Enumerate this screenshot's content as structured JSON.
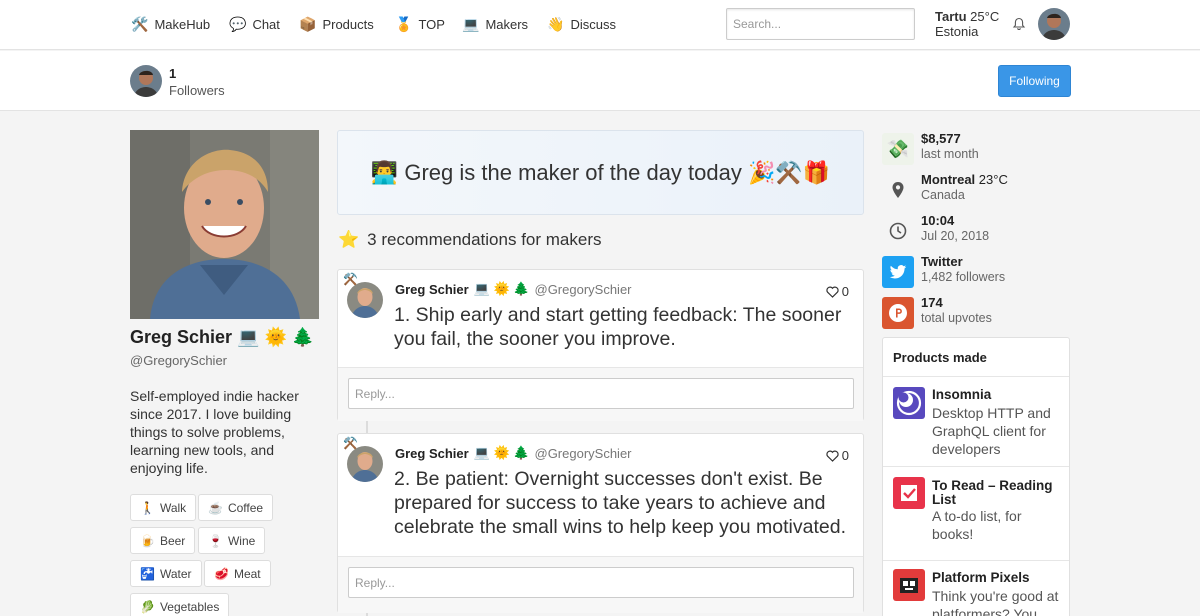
{
  "nav": {
    "items": [
      {
        "icon": "🛠️",
        "label": "MakeHub"
      },
      {
        "icon": "💬",
        "label": "Chat"
      },
      {
        "icon": "📦",
        "label": "Products"
      },
      {
        "icon": "🏅",
        "label": "TOP"
      },
      {
        "icon": "💻",
        "label": "Makers"
      },
      {
        "icon": "👋",
        "label": "Discuss"
      }
    ],
    "search_placeholder": "Search...",
    "weather": {
      "city": "Tartu",
      "temp": "25°C",
      "country": "Estonia"
    }
  },
  "subbar": {
    "followers_count": "1",
    "followers_label": "Followers",
    "button_label": "Following"
  },
  "profile": {
    "name": "Greg Schier 💻 🌞 🌲",
    "handle": "@GregorySchier",
    "bio": "Self-employed indie hacker since 2017. I love building things to solve problems, learning new tools, and enjoying life.",
    "tags": [
      {
        "icon": "🚶",
        "label": "Walk"
      },
      {
        "icon": "☕",
        "label": "Coffee"
      },
      {
        "icon": "🍺",
        "label": "Beer"
      },
      {
        "icon": "🍷",
        "label": "Wine"
      },
      {
        "icon": "🚰",
        "label": "Water"
      },
      {
        "icon": "🥩",
        "label": "Meat"
      },
      {
        "icon": "🥬",
        "label": "Vegetables"
      }
    ]
  },
  "main": {
    "maker_of_day": "👨‍💻 Greg is the maker of the day today 🎉⚒️🎁",
    "recommendations_icon": "⭐",
    "recommendations_title": "3 recommendations for makers",
    "posts": [
      {
        "author": "Greg Schier",
        "author_emoji": "💻 🌞 🌲",
        "handle": "@GregorySchier",
        "likes": "0",
        "text": "1. Ship early and start getting feedback: The sooner you fail, the sooner you improve.",
        "reply_placeholder": "Reply..."
      },
      {
        "author": "Greg Schier",
        "author_emoji": "💻 🌞 🌲",
        "handle": "@GregorySchier",
        "likes": "0",
        "text": "2. Be patient: Overnight successes don't exist. Be prepared for success to take years to achieve and celebrate the small wins to help keep you motivated.",
        "reply_placeholder": "Reply..."
      }
    ]
  },
  "sidebar": {
    "revenue": {
      "value": "$8,577",
      "label": "last month",
      "icon": "money-icon"
    },
    "location": {
      "city": "Montreal",
      "temp": "23°C",
      "country": "Canada",
      "icon": "pin-icon"
    },
    "time": {
      "value": "10:04",
      "date": "Jul 20, 2018",
      "icon": "clock-icon"
    },
    "twitter": {
      "label": "Twitter",
      "followers": "1,482 followers",
      "icon": "twitter-icon",
      "color": "#1da1f2"
    },
    "producthunt": {
      "value": "174",
      "label": "total upvotes",
      "icon": "producthunt-icon",
      "color": "#da552f"
    },
    "products_title": "Products made",
    "products": [
      {
        "name": "Insomnia",
        "desc": "Desktop HTTP and GraphQL client for developers",
        "color": "#5849be"
      },
      {
        "name": "To Read – Reading List",
        "desc": "A to-do list, for books!",
        "color": "#e8334a"
      },
      {
        "name": "Platform Pixels",
        "desc": "Think you're good at platformers? You",
        "color": "#e23b3b"
      }
    ]
  }
}
